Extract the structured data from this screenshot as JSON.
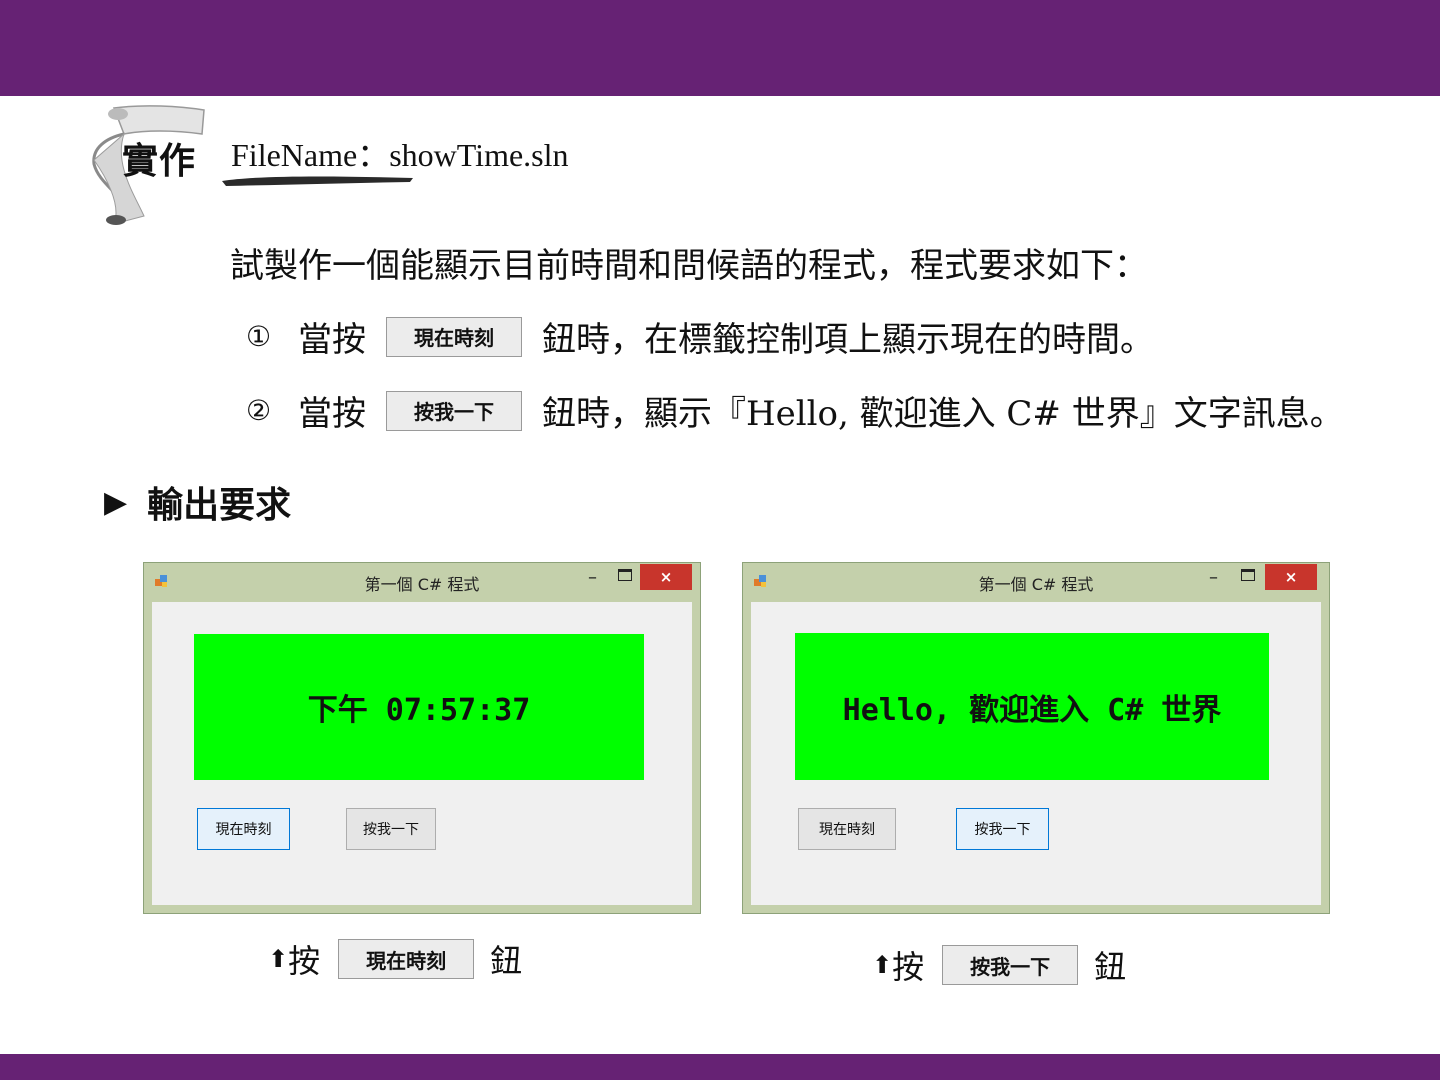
{
  "header": {
    "badge": "實作",
    "filename": "FileName：showTime.sln"
  },
  "intro": "試製作一個能顯示目前時間和問候語的程式，程式要求如下：",
  "requirements": [
    {
      "num": "①",
      "pre": "當按",
      "button": "現在時刻",
      "post": "鈕時，在標籤控制項上顯示現在的時間。"
    },
    {
      "num": "②",
      "pre": "當按",
      "button": "按我一下",
      "post": "鈕時，顯示『Hello,  歡迎進入 C#  世界』文字訊息。"
    }
  ],
  "section": {
    "marker": "▶",
    "title": "輸出要求"
  },
  "windows": [
    {
      "title": "第一個 C# 程式",
      "label": "下午 07:57:37",
      "buttons": [
        "現在時刻",
        "按我一下"
      ],
      "focused": 0,
      "caption": {
        "arrow": "⬆",
        "pre": "按",
        "button": "現在時刻",
        "post": "鈕"
      }
    },
    {
      "title": "第一個 C# 程式",
      "label": "Hello, 歡迎進入 C# 世界",
      "buttons": [
        "現在時刻",
        "按我一下"
      ],
      "focused": 1,
      "caption": {
        "arrow": "⬆",
        "pre": "按",
        "button": "按我一下",
        "post": "鈕"
      }
    }
  ],
  "titlebar_glyphs": {
    "minimize": "–",
    "close": "×"
  },
  "colors": {
    "banner": "#662274",
    "label_bg": "#00ff00",
    "close": "#c8352c",
    "window_frame": "#c4d0ab"
  },
  "icons": [
    "scroll-icon",
    "app-icon",
    "minimize-icon",
    "maximize-icon",
    "close-icon",
    "up-arrow-icon"
  ]
}
